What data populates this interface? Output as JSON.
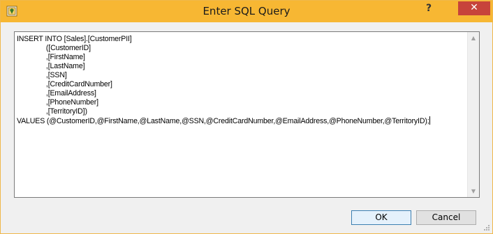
{
  "window": {
    "title": "Enter SQL Query",
    "help_label": "?",
    "close_label": "✕"
  },
  "editor": {
    "sql_lines": [
      "INSERT INTO [Sales].[CustomerPII]",
      "               ([CustomerID]",
      "               ,[FirstName]",
      "               ,[LastName]",
      "               ,[SSN]",
      "               ,[CreditCardNumber]",
      "               ,[EmailAddress]",
      "               ,[PhoneNumber]",
      "               ,[TerritoryID])",
      "VALUES (@CustomerID,@FirstName,@LastName,@SSN,@CreditCardNumber,@EmailAddress,@PhoneNumber,@TerritoryID);"
    ],
    "scroll_up_icon": "▲",
    "scroll_down_icon": "▼"
  },
  "buttons": {
    "ok_label": "OK",
    "cancel_label": "Cancel"
  },
  "colors": {
    "titlebar": "#f7b733",
    "close_button": "#c7433b",
    "dialog_background": "#f0f0f0"
  },
  "icons": {
    "app": "sql-wizard-icon",
    "resize": "resize-grip-icon"
  }
}
